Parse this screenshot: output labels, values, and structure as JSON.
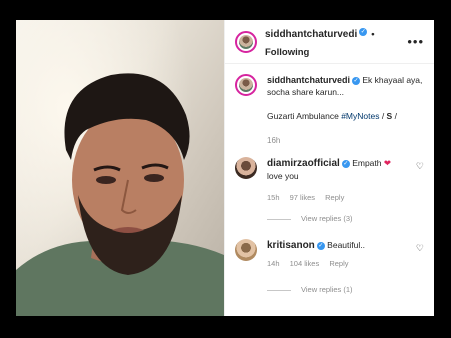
{
  "post": {
    "author": "siddhantchaturvedi",
    "follow_state": "• Following",
    "more_icon": "more-options-icon",
    "caption": {
      "text_line1": "Ek khayaal aya,",
      "text_line2": "socha share karun...",
      "text_line3_prefix": "Guzarti Ambulance ",
      "hashtag": "#MyNotes",
      "suffix": " / ",
      "bold_s": "S",
      "suffix2": " /",
      "time": "16h"
    }
  },
  "comments": [
    {
      "user": "diamirzaofficial",
      "text_line1": "Empath",
      "emoji": "❤",
      "text_line2": "love you",
      "time": "15h",
      "likes": "97 likes",
      "reply": "Reply",
      "view_replies": "View replies (3)"
    },
    {
      "user": "kritisanon",
      "text_line1": "Beautiful..",
      "time": "14h",
      "likes": "104 likes",
      "reply": "Reply",
      "view_replies": "View replies (1)"
    }
  ],
  "colors": {
    "background": "#000000",
    "panel": "#ffffff",
    "verified": "#3897f0",
    "link": "#00376b",
    "muted": "#8e8e8e"
  }
}
